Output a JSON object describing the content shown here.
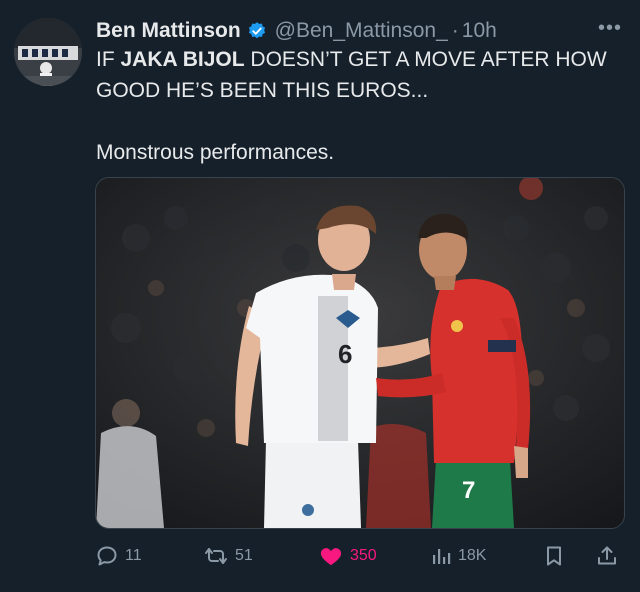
{
  "author": {
    "display_name": "Ben Mattinson",
    "handle": "@Ben_Mattinson_",
    "time": "10h",
    "verified": true
  },
  "more_icon": "more-dots-icon",
  "tweet": {
    "line1_prefix": "IF ",
    "line1_bold": "JAKA BIJOL",
    "line1_suffix": " DOESN’T GET A MOVE AFTER HOW",
    "line2": "GOOD HE’S BEEN THIS EUROS...",
    "line3": "Monstrous performances."
  },
  "media": {
    "shirt_number_white": "6",
    "shirt_number_red": "7"
  },
  "actions": {
    "reply_count": "11",
    "retweet_count": "51",
    "like_count": "350",
    "views_count": "18K"
  },
  "colors": {
    "background": "#15202b",
    "verified": "#1d9bf0",
    "like": "#f91880",
    "secondary_text": "#8b98a5"
  }
}
